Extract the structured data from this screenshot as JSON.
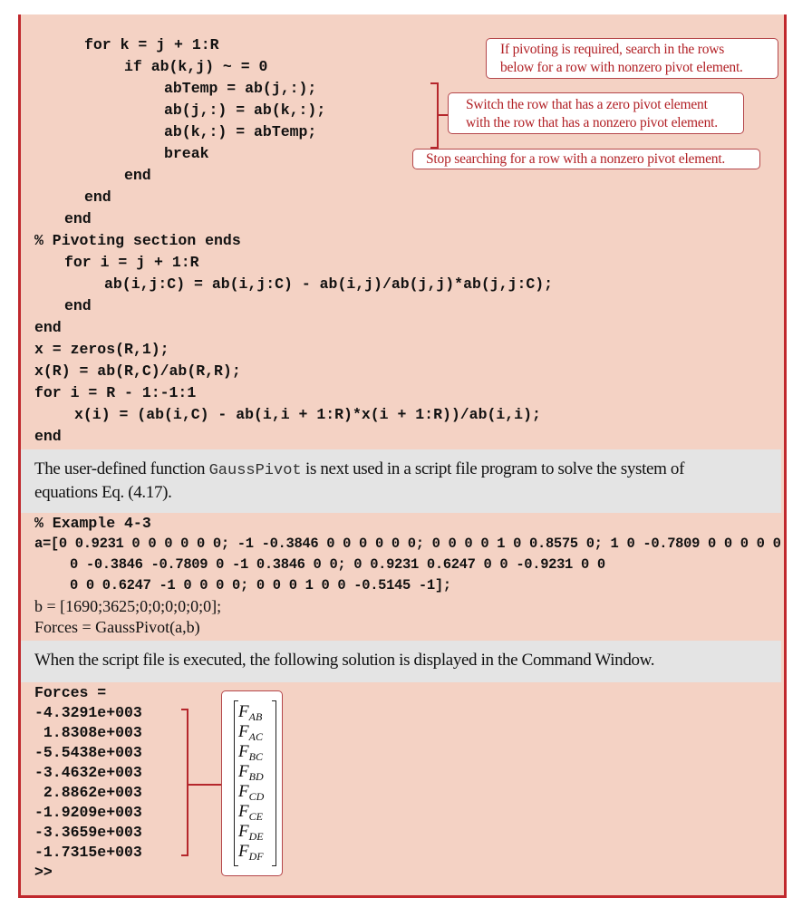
{
  "code_block_1": {
    "lines": [
      "for k = j + 1:R",
      "if ab(k,j) ~ = 0",
      "abTemp = ab(j,:);",
      "ab(j,:) = ab(k,:);",
      "ab(k,:) = abTemp;",
      "break",
      "end",
      "end",
      "end",
      "% Pivoting section ends",
      "for i = j + 1:R",
      "ab(i,j:C) = ab(i,j:C) - ab(i,j)/ab(j,j)*ab(j,j:C);",
      "end",
      "end",
      "x = zeros(R,1);",
      "x(R) = ab(R,C)/ab(R,R);",
      "for i = R - 1:-1:1",
      "x(i) = (ab(i,C) - ab(i,i + 1:R)*x(i + 1:R))/ab(i,i);",
      "end"
    ]
  },
  "callouts": {
    "search_rows": "If pivoting is required, search in the rows\nbelow for a row with nonzero pivot element.",
    "switch_rows": "Switch the row that has a zero pivot element\nwith the row that has a nonzero pivot element.",
    "stop_search": "Stop searching for a row with a nonzero pivot element."
  },
  "prose_1": {
    "before": "The user-defined function ",
    "code": "GaussPivot",
    "after_line1": " is next used in a script file program to solve the system of",
    "line2": "equations Eq. (4.17)."
  },
  "code_block_2": {
    "comment": "% Example 4-3",
    "a_line1": "a=[0 0.9231 0 0 0 0 0 0; -1 -0.3846 0 0 0 0 0 0; 0 0 0 0 1 0 0.8575 0; 1 0 -0.7809 0 0 0 0 0",
    "a_line2": "0 -0.3846 -0.7809 0 -1 0.3846 0 0; 0 0.9231 0.6247 0 0 -0.9231 0 0",
    "a_line3": "0 0 0.6247 -1 0 0 0 0; 0 0 0 1 0 0 -0.5145 -1];",
    "b_line": "b = [1690;3625;0;0;0;0;0;0];",
    "call_line": "Forces = GaussPivot(a,b)"
  },
  "prose_2": {
    "text": "When the script file is executed, the following solution is displayed in the Command Window."
  },
  "output": {
    "header": "Forces =",
    "values": [
      "-4.3291e+003",
      " 1.8308e+003",
      "-5.5438e+003",
      "-3.4632e+003",
      " 2.8862e+003",
      "-1.9209e+003",
      "-3.3659e+003",
      "-1.7315e+003"
    ],
    "prompt": ">>",
    "force_labels": [
      {
        "base": "F",
        "sub": "AB"
      },
      {
        "base": "F",
        "sub": "AC"
      },
      {
        "base": "F",
        "sub": "BC"
      },
      {
        "base": "F",
        "sub": "BD"
      },
      {
        "base": "F",
        "sub": "CD"
      },
      {
        "base": "F",
        "sub": "CE"
      },
      {
        "base": "F",
        "sub": "DE"
      },
      {
        "base": "F",
        "sub": "DF"
      }
    ]
  },
  "colors": {
    "frame_border": "#c0282d",
    "code_background": "#f4d2c4",
    "prose_background": "#e4e4e4",
    "callout_text": "#b11f24"
  }
}
